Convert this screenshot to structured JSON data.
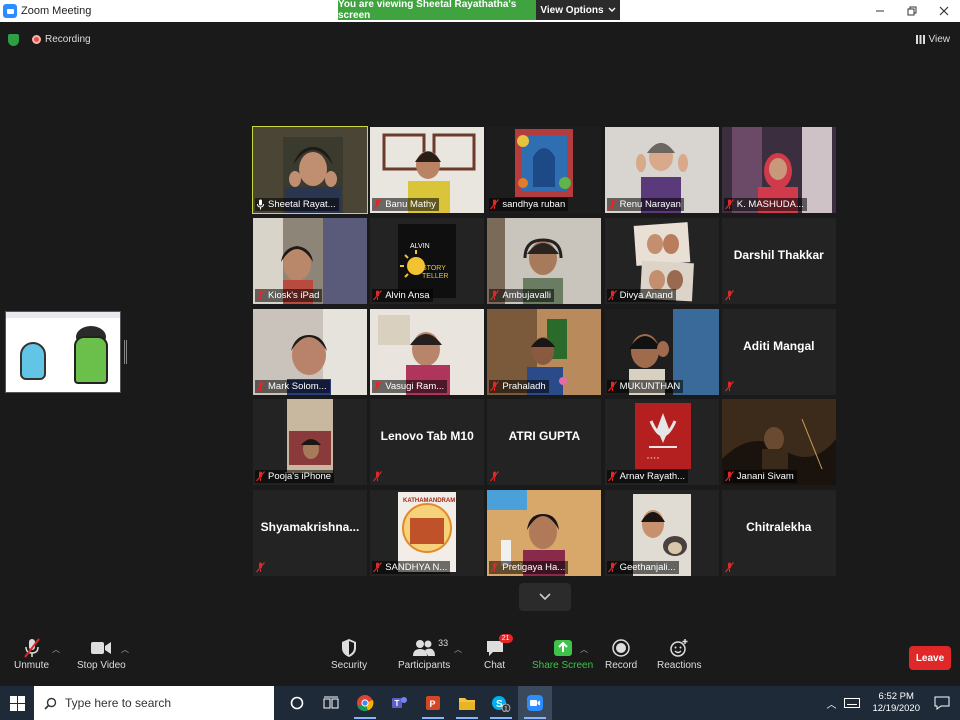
{
  "window": {
    "title": "Zoom Meeting"
  },
  "banner": {
    "viewing_text": "You are viewing Sheetal Rayathatha's screen",
    "view_options_label": "View Options"
  },
  "status": {
    "recording_label": "Recording",
    "view_label": "View"
  },
  "tiles": [
    {
      "name": "Sheetal Rayat...",
      "kind": "video",
      "active": true,
      "muted": false
    },
    {
      "name": "Banu Mathy",
      "kind": "video",
      "muted": true
    },
    {
      "name": "sandhya ruban",
      "kind": "video",
      "muted": true
    },
    {
      "name": "Renu Narayan",
      "kind": "video",
      "muted": true
    },
    {
      "name": "K. MASHUDA...",
      "kind": "video",
      "muted": true
    },
    {
      "name": "Kiosk's iPad",
      "kind": "video",
      "muted": true
    },
    {
      "name": "Alvin Ansa",
      "kind": "video",
      "muted": true,
      "art_text": "ALVIN STORYTELLER"
    },
    {
      "name": "Ambujavalli",
      "kind": "video",
      "muted": true
    },
    {
      "name": "Divya Anand",
      "kind": "video",
      "muted": true
    },
    {
      "name": "Darshil Thakkar",
      "kind": "name"
    },
    {
      "name": "Mark Solom...",
      "kind": "video",
      "muted": true
    },
    {
      "name": "Vasugi Ram...",
      "kind": "video",
      "muted": true
    },
    {
      "name": "Prahaladh",
      "kind": "video",
      "muted": true
    },
    {
      "name": "MUKUNTHAN",
      "kind": "video",
      "muted": true
    },
    {
      "name": "Aditi Mangal",
      "kind": "name"
    },
    {
      "name": "Pooja's iPhone",
      "kind": "video",
      "muted": true
    },
    {
      "name": "Lenovo Tab M10",
      "kind": "name"
    },
    {
      "name": "ATRI GUPTA",
      "kind": "name"
    },
    {
      "name": "Arnav Rayath...",
      "kind": "video",
      "muted": true
    },
    {
      "name": "Janani Sivam",
      "kind": "video",
      "muted": true
    },
    {
      "name": "Shyamakrishna...",
      "kind": "name"
    },
    {
      "name": "SANDHYA N...",
      "kind": "video",
      "muted": true,
      "art_text": "KATHAMANDRAM"
    },
    {
      "name": "Pretigaya Ha...",
      "kind": "video",
      "muted": true
    },
    {
      "name": "Geethanjali...",
      "kind": "video",
      "muted": true
    },
    {
      "name": "Chitralekha",
      "kind": "name"
    }
  ],
  "toolbar": {
    "unmute_label": "Unmute",
    "stop_video_label": "Stop Video",
    "security_label": "Security",
    "participants_label": "Participants",
    "participants_count": "33",
    "chat_label": "Chat",
    "chat_badge": "21",
    "share_screen_label": "Share Screen",
    "record_label": "Record",
    "reactions_label": "Reactions",
    "leave_label": "Leave"
  },
  "taskbar": {
    "search_placeholder": "Type here to search",
    "time": "6:52 PM",
    "date": "12/19/2020",
    "skype_badge": "1"
  },
  "colors": {
    "active_speaker": "#c9d93a",
    "share_green": "#3fc24a",
    "leave_red": "#e02828",
    "banner_green": "#3fa43f"
  }
}
